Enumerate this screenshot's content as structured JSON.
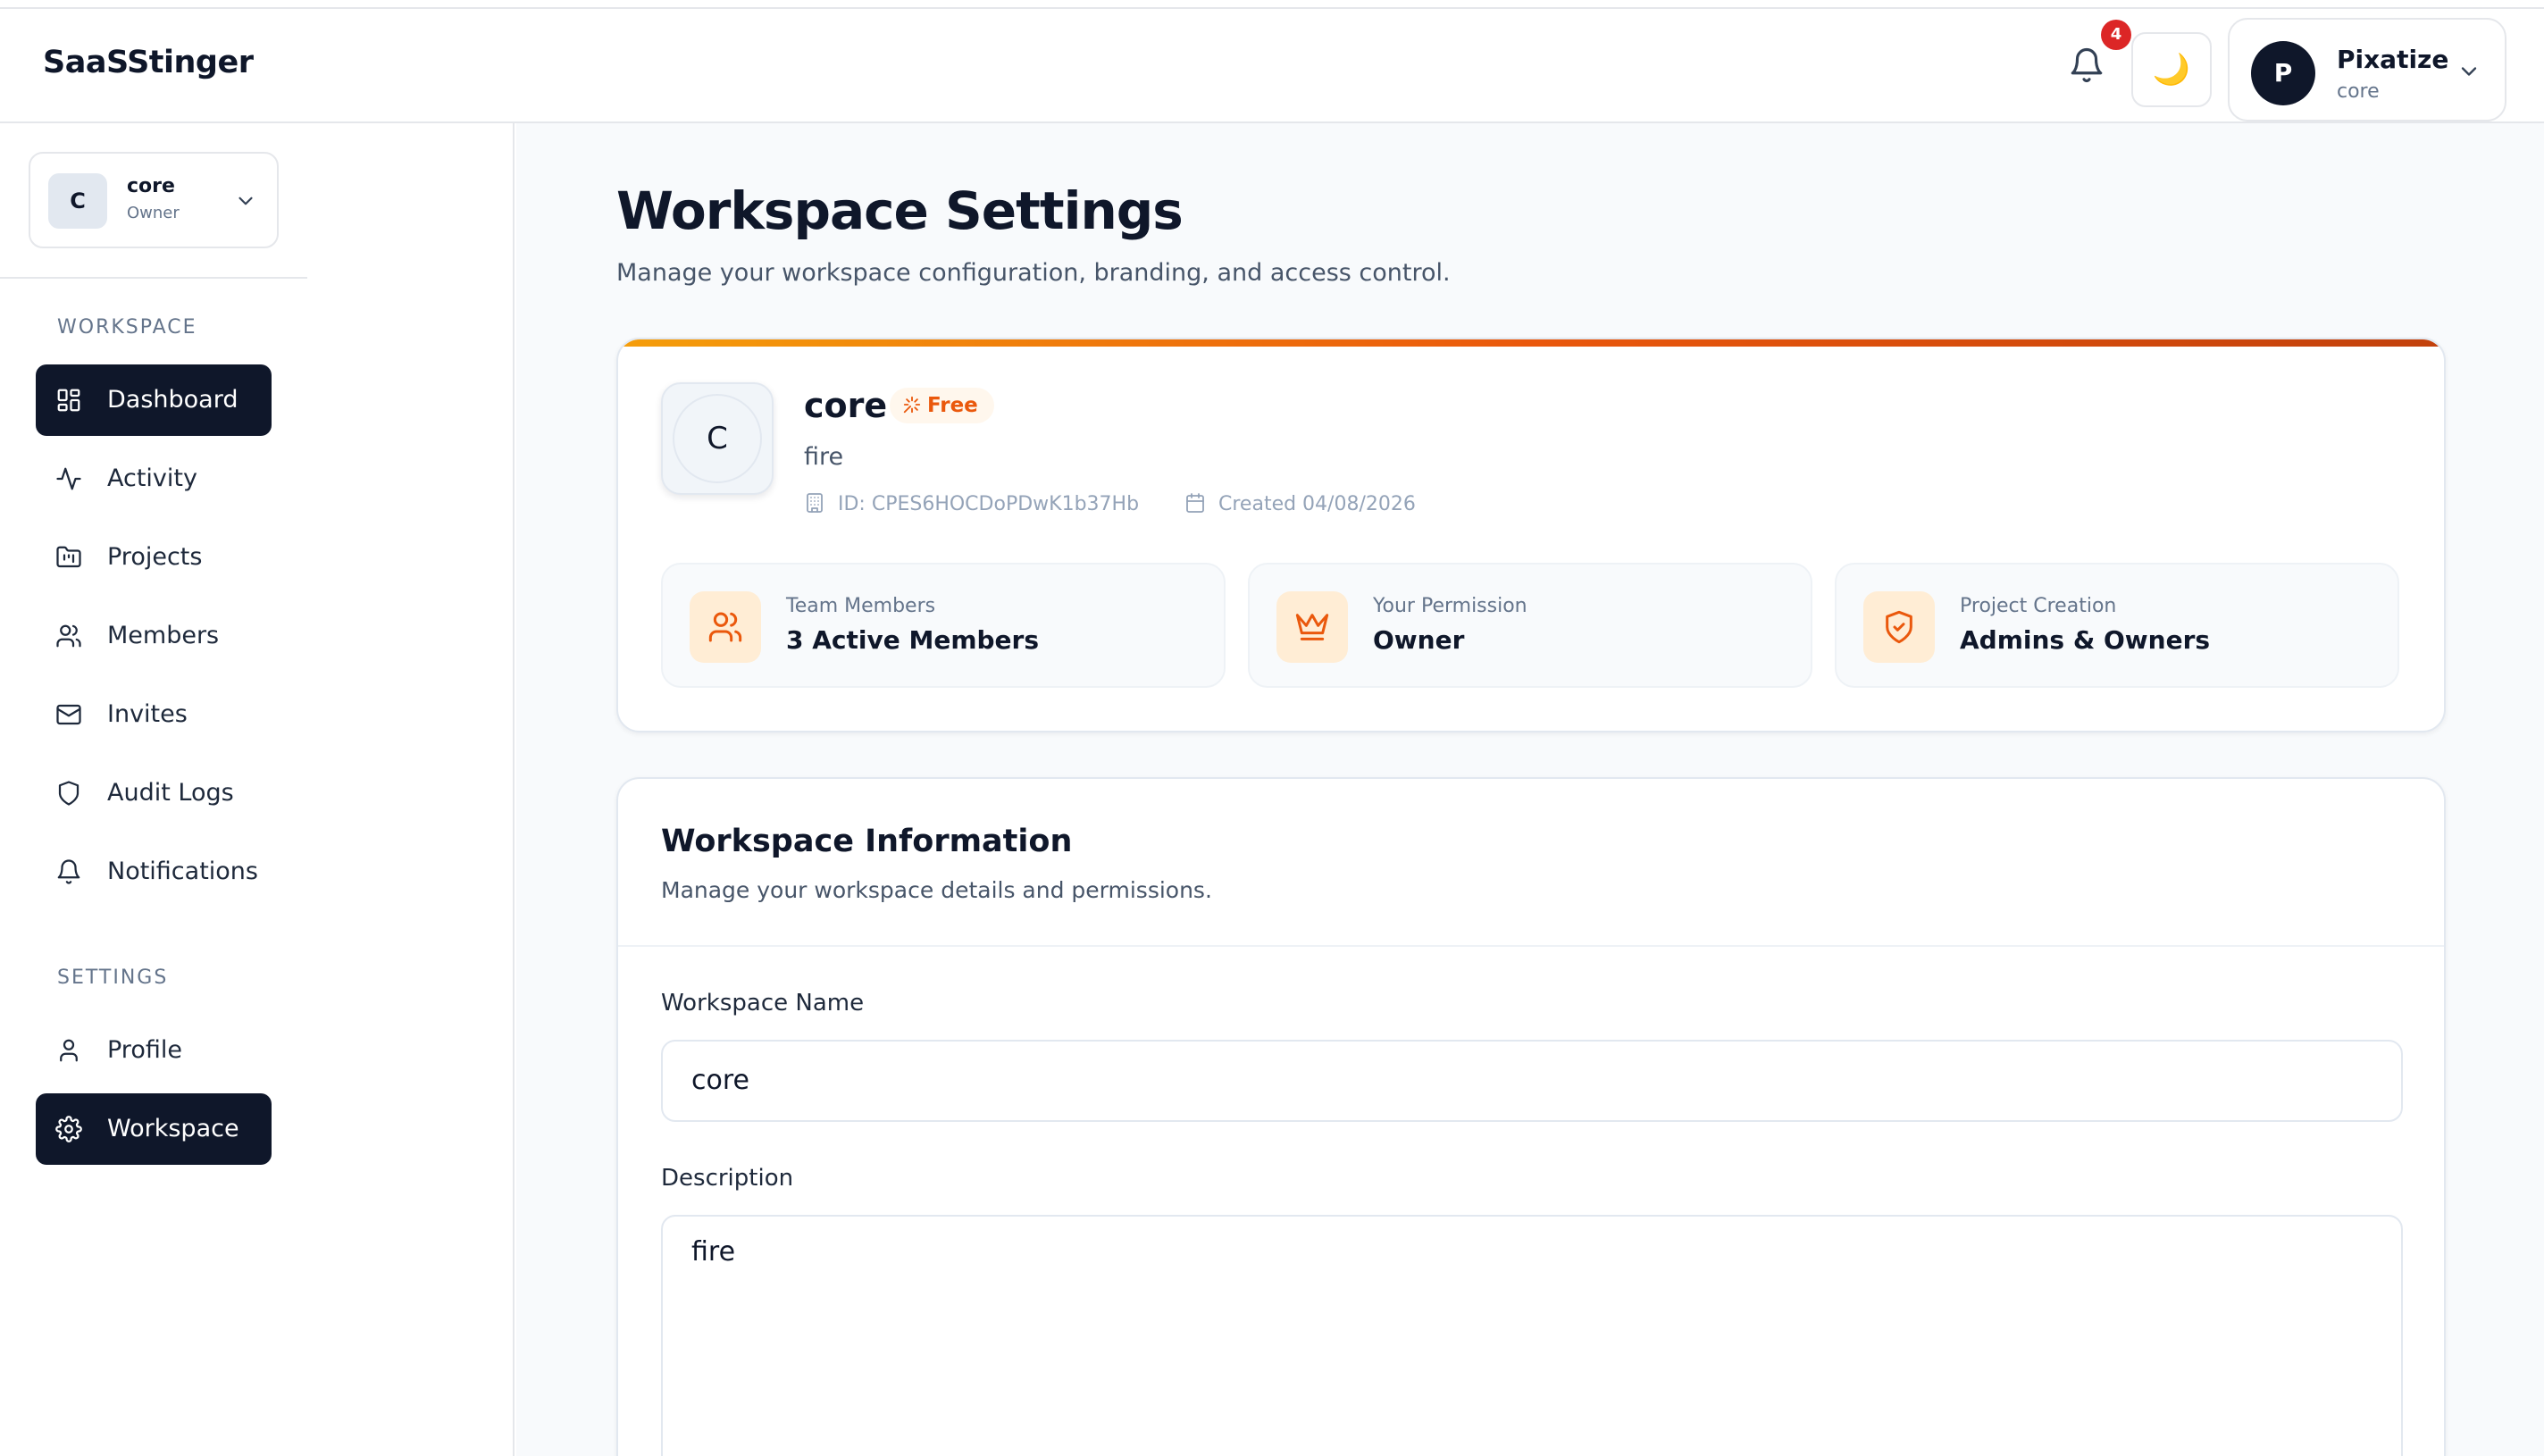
{
  "app": {
    "brand": "SaaSStinger"
  },
  "header": {
    "notifications_badge": "4",
    "theme_toggle_icon": "🌙",
    "user": {
      "initial": "P",
      "name": "Pixatize",
      "workspace": "core"
    }
  },
  "sidebar": {
    "workspace_switcher": {
      "initial": "C",
      "name": "core",
      "role": "Owner"
    },
    "sections": {
      "workspace": "WORKSPACE",
      "settings": "SETTINGS"
    },
    "items": [
      {
        "label": "Dashboard",
        "icon": "dashboard-icon",
        "active": true
      },
      {
        "label": "Activity",
        "icon": "activity-icon",
        "active": false
      },
      {
        "label": "Projects",
        "icon": "folder-icon",
        "active": false
      },
      {
        "label": "Members",
        "icon": "users-icon",
        "active": false
      },
      {
        "label": "Invites",
        "icon": "mail-icon",
        "active": false
      },
      {
        "label": "Audit Logs",
        "icon": "shield-icon",
        "active": false
      },
      {
        "label": "Notifications",
        "icon": "bell-icon",
        "active": false
      }
    ],
    "settings_items": [
      {
        "label": "Profile",
        "icon": "user-icon",
        "active": false
      },
      {
        "label": "Workspace",
        "icon": "gear-icon",
        "active": true
      }
    ]
  },
  "page": {
    "title": "Workspace Settings",
    "subtitle": "Manage your workspace configuration, branding, and access control."
  },
  "workspace_card": {
    "initial": "C",
    "name": "core",
    "plan": "Free",
    "description": "fire",
    "id_text": "ID: CPES6HOCDoPDwK1b37Hb",
    "created_text": "Created 04/08/2026",
    "accent_colors": [
      "#f59e0b",
      "#ea580c",
      "#c2410c"
    ],
    "stats": [
      {
        "label": "Team Members",
        "value": "3 Active Members",
        "icon": "users-icon"
      },
      {
        "label": "Your Permission",
        "value": "Owner",
        "icon": "crown-icon"
      },
      {
        "label": "Project Creation",
        "value": "Admins & Owners",
        "icon": "shield-check-icon"
      }
    ]
  },
  "info_card": {
    "title": "Workspace Information",
    "subtitle": "Manage your workspace details and permissions.",
    "fields": {
      "name_label": "Workspace Name",
      "name_value": "core",
      "description_label": "Description",
      "description_value": "fire"
    }
  }
}
